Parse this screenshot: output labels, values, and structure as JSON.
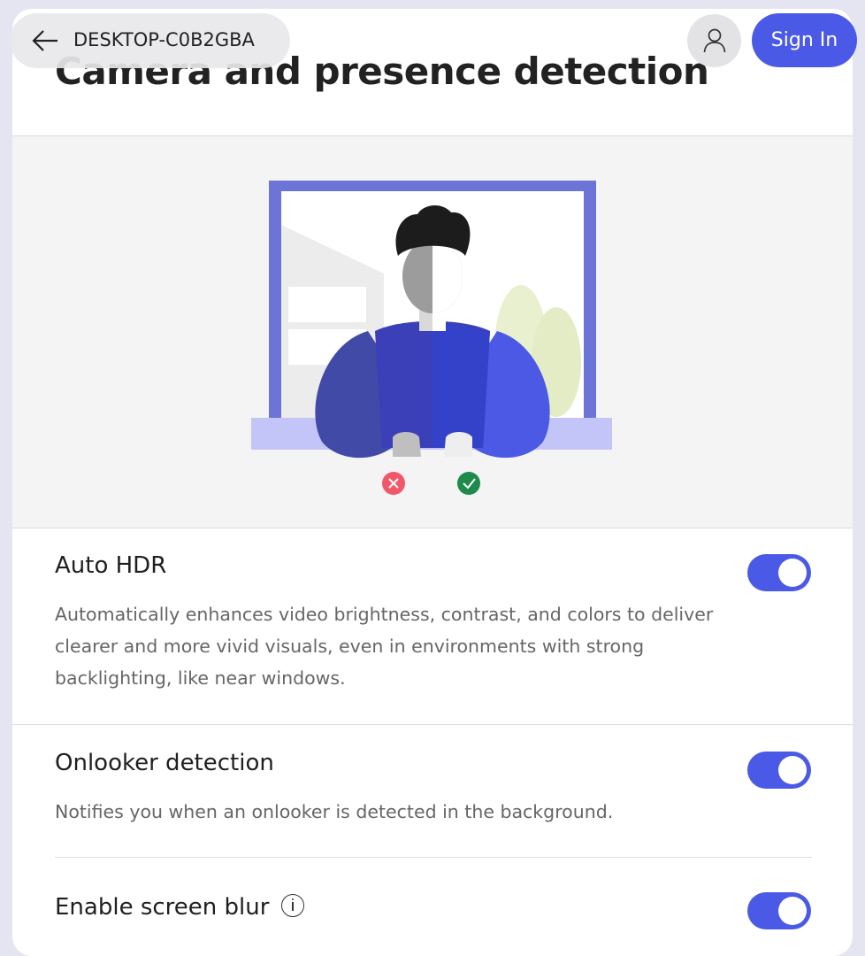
{
  "header": {
    "device_name": "DESKTOP-C0B2GBA",
    "sign_in_label": "Sign In",
    "icons": {
      "back": "arrow-left-icon",
      "account": "person-icon"
    }
  },
  "page": {
    "title": "Camera and presence detection"
  },
  "illustration": {
    "subject": "person-at-window",
    "status_icons": [
      "x-icon",
      "check-icon"
    ],
    "colors": {
      "frame": "#6c74d8",
      "sill": "#c3c5f8",
      "shirt": "#3b3fb8",
      "bad": "#f0586a",
      "good": "#1e8a4c"
    }
  },
  "settings": [
    {
      "id": "auto-hdr",
      "title": "Auto HDR",
      "description": "Automatically enhances video brightness, contrast, and colors to deliver clearer and more vivid visuals, even in environments with strong backlighting, like near windows.",
      "enabled": true
    },
    {
      "id": "onlooker-detection",
      "title": "Onlooker detection",
      "description": "Notifies you when an onlooker is detected in the background.",
      "enabled": true
    },
    {
      "id": "screen-blur",
      "title": "Enable screen blur",
      "has_info": true,
      "enabled": true
    }
  ],
  "colors": {
    "accent": "#4b5ae6",
    "background": "#e4e5f1",
    "card": "#ffffff",
    "hero_bg": "#f4f4f4"
  }
}
